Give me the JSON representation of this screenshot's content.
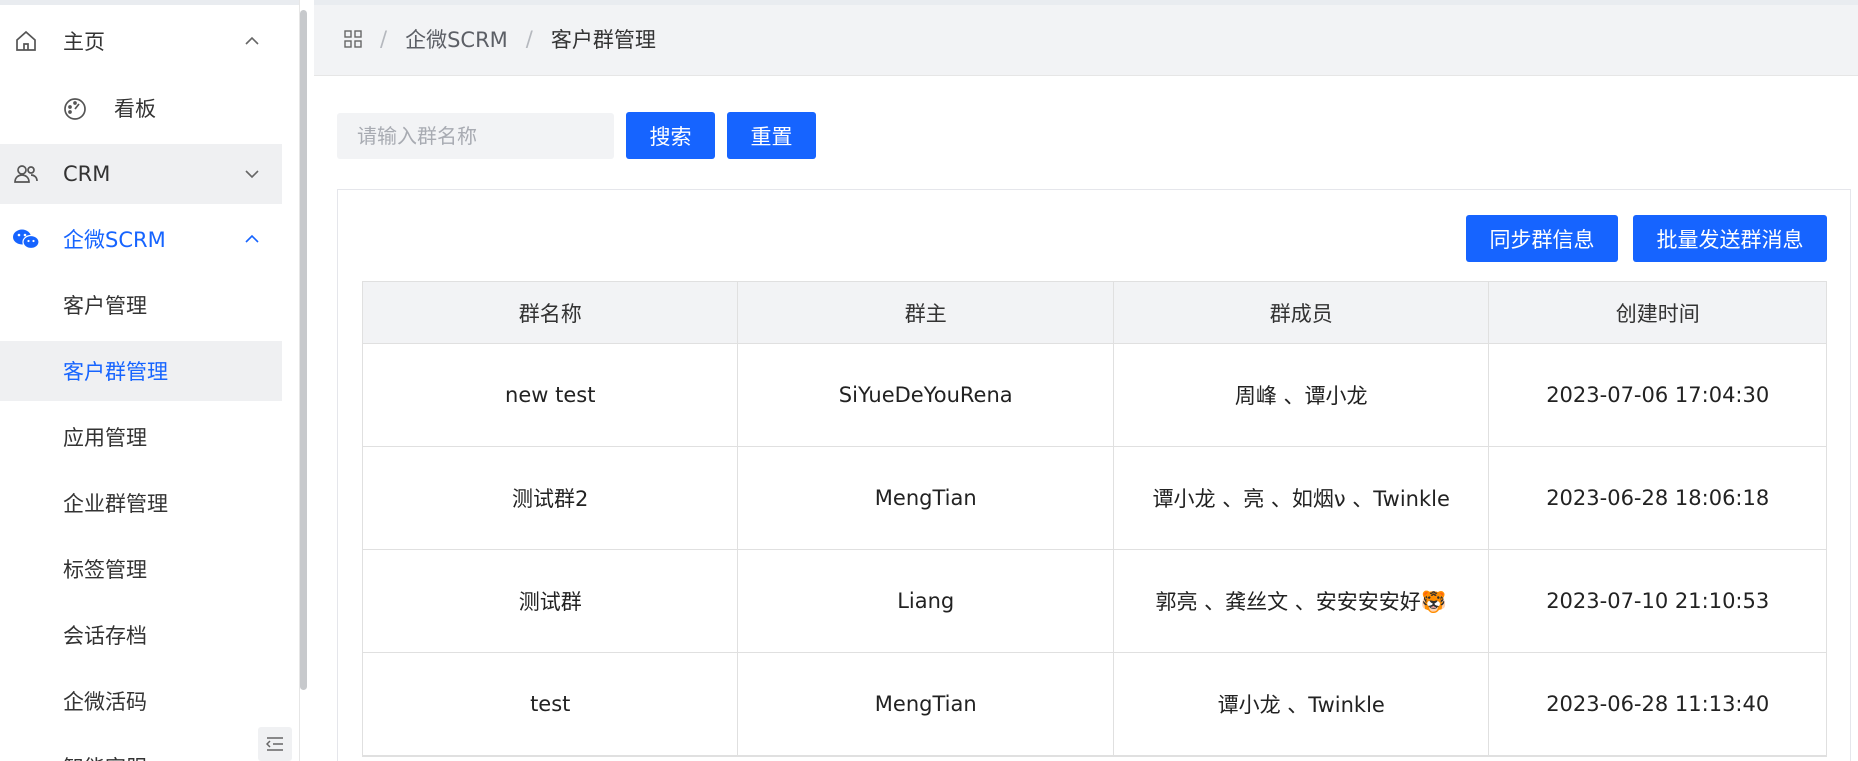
{
  "sidebar": {
    "menus": [
      {
        "label": "主页",
        "icon": "home-icon",
        "chevron": "up"
      },
      {
        "label": "CRM",
        "icon": "users-icon",
        "chevron": "down"
      },
      {
        "label": "企微SCRM",
        "icon": "wechat-icon",
        "chevron": "up"
      }
    ],
    "dashboard_label": "看板",
    "dashboard_icon": "dashboard-gauge-icon",
    "scrm_items": [
      {
        "label": "客户管理"
      },
      {
        "label": "客户群管理"
      },
      {
        "label": "应用管理"
      },
      {
        "label": "企业群管理"
      },
      {
        "label": "标签管理"
      },
      {
        "label": "会话存档"
      },
      {
        "label": "企微活码"
      },
      {
        "label": "智能客服"
      }
    ],
    "collapse_icon": "menu-fold-icon"
  },
  "breadcrumb": {
    "home_icon": "apps-grid-icon",
    "items": [
      "企微SCRM",
      "客户群管理"
    ],
    "separator": "/"
  },
  "search": {
    "placeholder": "请输入群名称",
    "value": "",
    "search_label": "搜索",
    "reset_label": "重置"
  },
  "actions": {
    "sync_label": "同步群信息",
    "batch_send_label": "批量发送群消息"
  },
  "table": {
    "headers": [
      "群名称",
      "群主",
      "群成员",
      "创建时间"
    ],
    "rows": [
      [
        "new test",
        "SiYueDeYouRena",
        "周峰 、谭小龙",
        "2023-07-06 17:04:30"
      ],
      [
        "测试群2",
        "MengTian",
        "谭小龙 、亮 、如烟ν 、Twinkle",
        "2023-06-28 18:06:18"
      ],
      [
        "测试群",
        "Liang",
        "郭亮 、龚丝文 、安安安安好🐯",
        "2023-07-10 21:10:53"
      ],
      [
        "test",
        "MengTian",
        "谭小龙 、Twinkle",
        "2023-06-28 11:13:40"
      ]
    ]
  },
  "colors": {
    "accent": "#1664ff",
    "selected_bg": "#eff0f2",
    "header_bg": "#f2f3f5"
  }
}
